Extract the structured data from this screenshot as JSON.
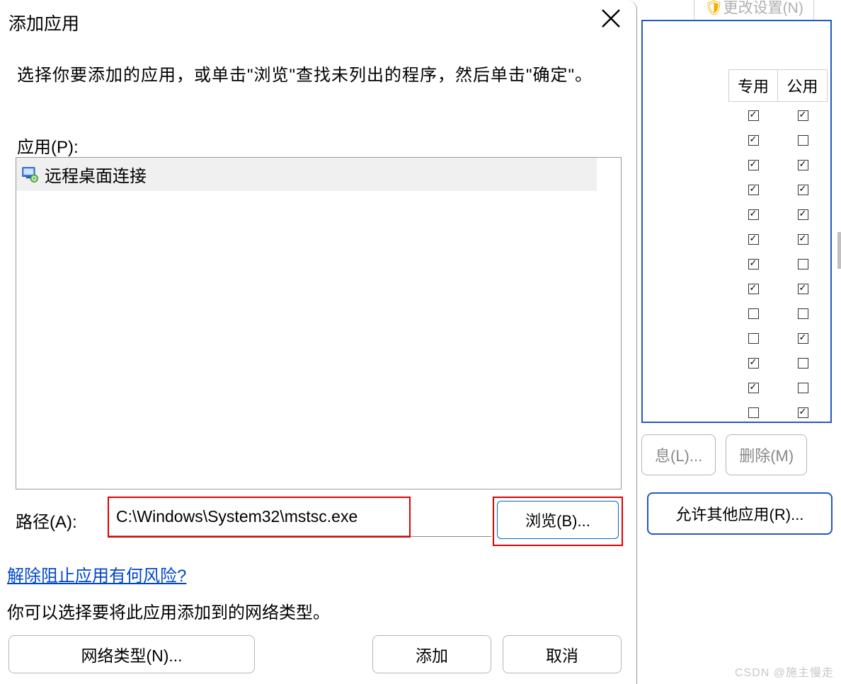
{
  "dialog": {
    "title": "添加应用",
    "instruction": "选择你要添加的应用，或单击\"浏览\"查找未列出的程序，然后单击\"确定\"。",
    "apps_label": "应用(P):",
    "apps": [
      {
        "name": "远程桌面连接",
        "icon": "rdp-icon"
      }
    ],
    "path_label": "路径(A):",
    "path_value": "C:\\Windows\\System32\\mstsc.exe",
    "browse_label": "浏览(B)...",
    "risk_link": "解除阻止应用有何风险?",
    "nettype_instruction": "你可以选择要将此应用添加到的网络类型。",
    "nettype_button": "网络类型(N)...",
    "add_button": "添加",
    "cancel_button": "取消"
  },
  "parent": {
    "change_settings": "更改设置(N)",
    "header_private": "专用",
    "header_public": "公用",
    "rows": [
      {
        "private": true,
        "public": true
      },
      {
        "private": true,
        "public": false
      },
      {
        "private": true,
        "public": true
      },
      {
        "private": true,
        "public": true
      },
      {
        "private": true,
        "public": true
      },
      {
        "private": true,
        "public": true
      },
      {
        "private": true,
        "public": false
      },
      {
        "private": true,
        "public": true
      },
      {
        "private": false,
        "public": false
      },
      {
        "private": false,
        "public": true
      },
      {
        "private": true,
        "public": false
      },
      {
        "private": true,
        "public": false
      },
      {
        "private": false,
        "public": true
      }
    ],
    "details_button": "息(L)...",
    "delete_button": "删除(M)",
    "allow_button": "允许其他应用(R)..."
  },
  "watermark": "CSDN @施主慢走"
}
